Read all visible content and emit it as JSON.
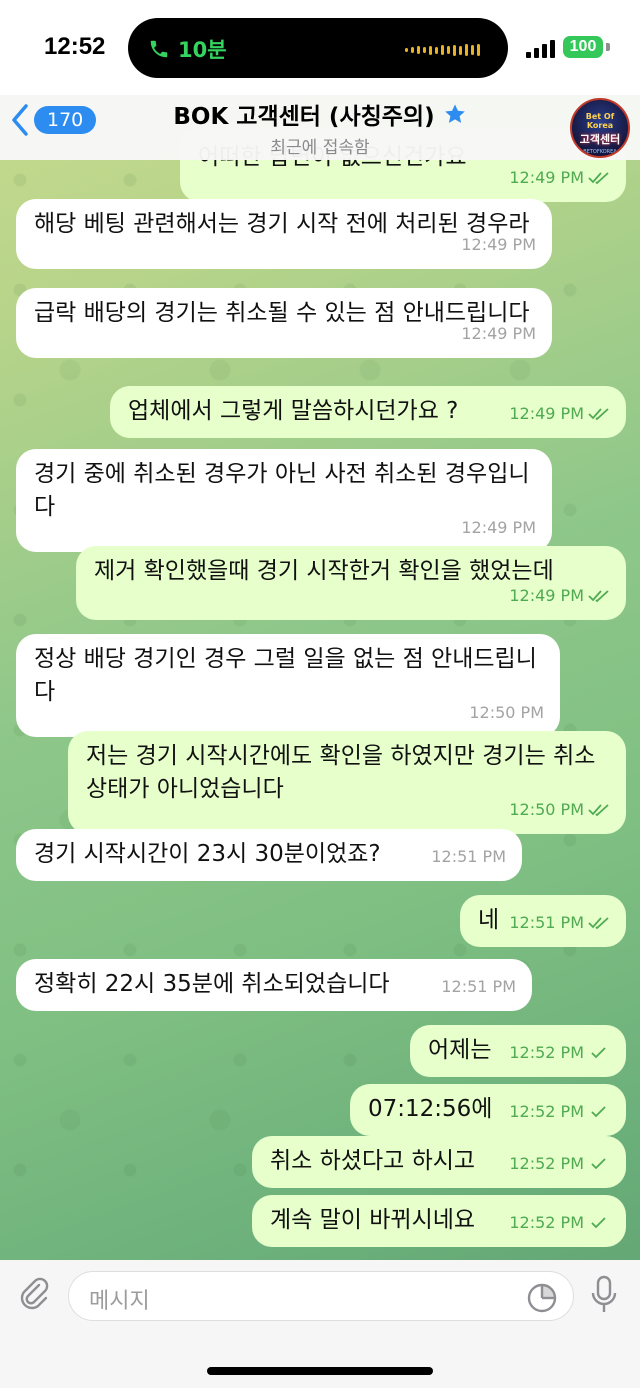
{
  "status_bar": {
    "time": "12:52",
    "call_duration": "10분",
    "battery": "100"
  },
  "header": {
    "back_count": "170",
    "title": "BOK 고객센터 (사칭주의)",
    "subtitle": "최근에 접속함",
    "avatar_line1": "Bet Of Korea",
    "avatar_line2": "고객센터",
    "avatar_line3": "BETOFKOREA"
  },
  "messages": [
    {
      "dir": "out",
      "text": "어떠한 답변이 없으신건가요",
      "time": "12:49 PM",
      "read": true
    },
    {
      "dir": "in",
      "text": "해당 베팅 관련해서는 경기 시작 전에 처리된 경우라",
      "time": "12:49 PM"
    },
    {
      "dir": "in",
      "text": "급락 배당의 경기는 취소될 수 있는 점 안내드립니다",
      "time": "12:49 PM"
    },
    {
      "dir": "out",
      "text": "업체에서 그렇게 말씀하시던가요 ?",
      "time": "12:49 PM",
      "read": true
    },
    {
      "dir": "in",
      "text": "경기 중에 취소된 경우가 아닌 사전 취소된 경우입니다",
      "time": "12:49 PM"
    },
    {
      "dir": "out",
      "text": "제거 확인했을때 경기 시작한거 확인을 했었는데",
      "time": "12:49 PM",
      "read": true
    },
    {
      "dir": "in",
      "text": "정상 배당 경기인 경우 그럴 일을 없는 점 안내드립니다",
      "time": "12:50 PM"
    },
    {
      "dir": "out",
      "text": "저는 경기 시작시간에도 확인을 하였지만 경기는 취소 상태가 아니었습니다",
      "time": "12:50 PM",
      "read": true
    },
    {
      "dir": "in",
      "text": "경기 시작시간이 23시 30분이었죠?",
      "time": "12:51 PM"
    },
    {
      "dir": "out",
      "text": "네",
      "time": "12:51 PM",
      "read": true
    },
    {
      "dir": "in",
      "text": "정확히 22시 35분에 취소되었습니다",
      "time": "12:51 PM"
    },
    {
      "dir": "out",
      "text": "어제는",
      "time": "12:52 PM",
      "read": false
    },
    {
      "dir": "out",
      "text": "07:12:56에",
      "time": "12:52 PM",
      "read": false
    },
    {
      "dir": "out",
      "text": "취소 하셨다고 하시고",
      "time": "12:52 PM",
      "read": false
    },
    {
      "dir": "out",
      "text": "계속 말이 바뀌시네요",
      "time": "12:52 PM",
      "read": false
    }
  ],
  "input": {
    "placeholder": "메시지"
  },
  "colors": {
    "accent": "#2d8cf0",
    "outgoing_bubble": "#e6ffcb",
    "incoming_bubble": "#ffffff",
    "tick": "#4faa52"
  }
}
